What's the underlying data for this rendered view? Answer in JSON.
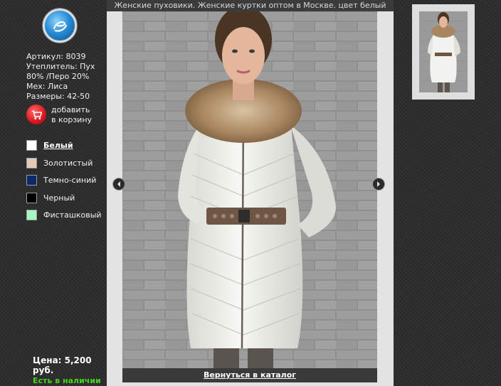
{
  "product": {
    "title": "Женские пуховики. Женские куртки оптом в Москве. цвет белый",
    "specs": {
      "article": "Артикул: 8039",
      "insulation_line1": "Утеплитель: Пух",
      "insulation_line2": "80% /Перо 20%",
      "fur": "Мех: Лиса",
      "sizes": "Размеры: 42-50"
    },
    "add_to_cart_line1": "добавить",
    "add_to_cart_line2": "в корзину",
    "price": "Цена: 5,200 руб.",
    "availability": "Есть в наличии",
    "back_link": "Вернуться в каталог"
  },
  "colors": [
    {
      "label": "Белый",
      "hex": "#ffffff",
      "selected": true
    },
    {
      "label": "Золотистый",
      "hex": "#e3cbb8",
      "selected": false
    },
    {
      "label": "Темно-синий",
      "hex": "#0b2a6b",
      "selected": false
    },
    {
      "label": "Черный",
      "hex": "#000000",
      "selected": false
    },
    {
      "label": "Фисташковый",
      "hex": "#a8f5c0",
      "selected": false
    }
  ],
  "theme": {
    "price_available_color": "#46d31e",
    "cart_icon_color": "#d9141e",
    "logo_color": "#2a8ed6"
  },
  "icons": {
    "logo": "brand-logo-icon",
    "cart": "shopping-cart-icon",
    "prev": "chevron-left-icon",
    "next": "chevron-right-icon"
  }
}
